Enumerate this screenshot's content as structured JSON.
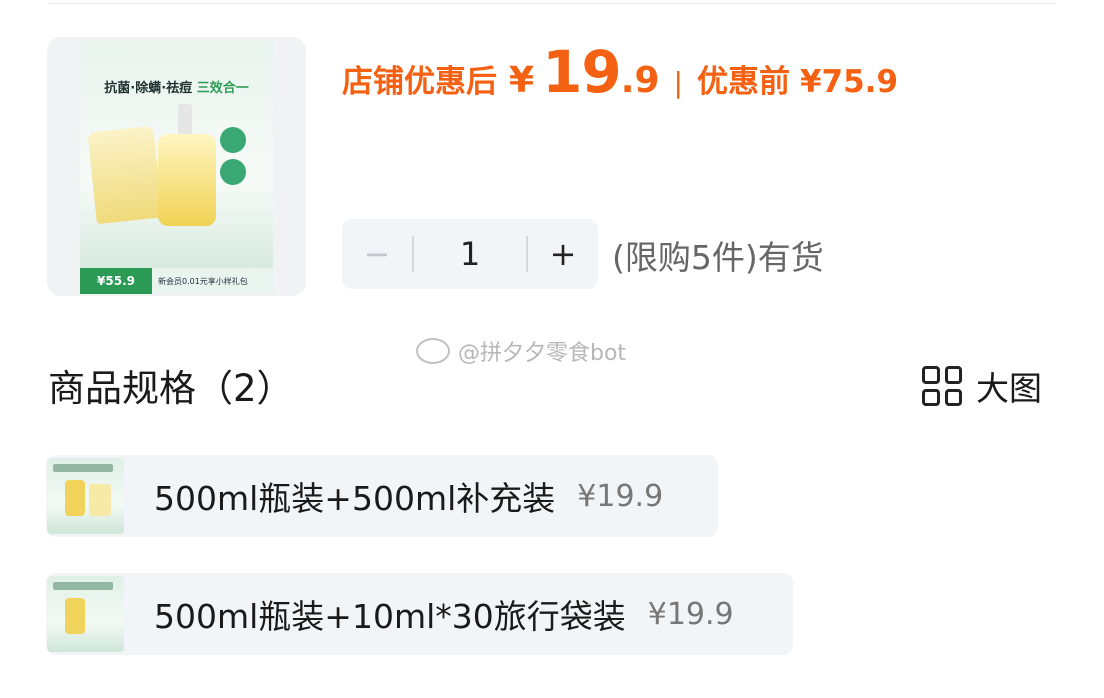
{
  "price": {
    "after_label": "店铺优惠后",
    "currency": "¥",
    "after_int": "19",
    "after_dec": ".9",
    "separator": "|",
    "before_label": "优惠前",
    "before_value": "¥75.9"
  },
  "stepper": {
    "minus": "−",
    "quantity": "1",
    "plus": "+",
    "limit_text": "(限购5件)有货"
  },
  "watermark": "@拼夕夕零食bot",
  "spec": {
    "title": "商品规格（2）",
    "big_view_label": "大图",
    "options": [
      {
        "name": "500ml瓶装+500ml补充装",
        "price": "¥19.9"
      },
      {
        "name": "500ml瓶装+10ml*30旅行袋装",
        "price": "¥19.9"
      }
    ]
  },
  "colors": {
    "accent": "#f56112",
    "option_bg": "#f2f5f8"
  },
  "icons": {
    "big_view": "grid-icon",
    "watermark_logo": "weibo-icon"
  }
}
